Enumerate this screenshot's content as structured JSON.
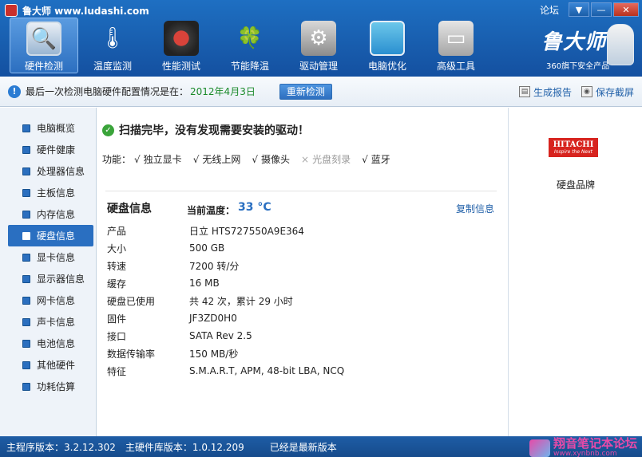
{
  "window": {
    "title": "鲁大师 www.ludashi.com",
    "forum_label": "论坛",
    "ctrl_menu": "▼",
    "ctrl_min": "—",
    "ctrl_close": "✕"
  },
  "toolbar": {
    "items": [
      {
        "label": "硬件检测",
        "icon": "monitor-magnifier-icon"
      },
      {
        "label": "温度监测",
        "icon": "thermometer-icon"
      },
      {
        "label": "性能测试",
        "icon": "speed-gauge-icon"
      },
      {
        "label": "节能降温",
        "icon": "clover-leaf-icon"
      },
      {
        "label": "驱动管理",
        "icon": "toolbox-icon"
      },
      {
        "label": "电脑优化",
        "icon": "display-icon"
      },
      {
        "label": "高级工具",
        "icon": "toolcase-icon"
      }
    ],
    "active_index": 0
  },
  "brand": {
    "logo_text": "鲁大师",
    "subtitle": "360旗下安全产品"
  },
  "infobar": {
    "text": "最后一次检测电脑硬件配置情况是在：",
    "date": "2012年4月3日",
    "recheck_label": "重新检测",
    "report_label": "生成报告",
    "screenshot_label": "保存截屏"
  },
  "sidebar": {
    "items": [
      {
        "label": "电脑概览"
      },
      {
        "label": "硬件健康"
      },
      {
        "label": "处理器信息"
      },
      {
        "label": "主板信息"
      },
      {
        "label": "内存信息"
      },
      {
        "label": "硬盘信息"
      },
      {
        "label": "显卡信息"
      },
      {
        "label": "显示器信息"
      },
      {
        "label": "网卡信息"
      },
      {
        "label": "声卡信息"
      },
      {
        "label": "电池信息"
      },
      {
        "label": "其他硬件"
      },
      {
        "label": "功耗估算"
      }
    ],
    "active_index": 5
  },
  "main": {
    "scan_message": "扫描完毕，没有发现需要安装的驱动！",
    "features_label": "功能：",
    "features": [
      {
        "mark": "√",
        "label": "独立显卡",
        "enabled": true
      },
      {
        "mark": "√",
        "label": "无线上网",
        "enabled": true
      },
      {
        "mark": "√",
        "label": "摄像头",
        "enabled": true
      },
      {
        "mark": "×",
        "label": "光盘刻录",
        "enabled": false
      },
      {
        "mark": "√",
        "label": "蓝牙",
        "enabled": true
      }
    ],
    "disk_title": "硬盘信息",
    "temp_label": "当前温度：",
    "temp_value": "33 °C",
    "copy_label": "复制信息",
    "specs": [
      {
        "key": "产品",
        "value": "日立  HTS727550A9E364"
      },
      {
        "key": "大小",
        "value": "500 GB"
      },
      {
        "key": "转速",
        "value": "7200 转/分"
      },
      {
        "key": "缓存",
        "value": "16 MB"
      },
      {
        "key": "硬盘已使用",
        "value": "共 42 次，累计 29 小时"
      },
      {
        "key": "固件",
        "value": "JF3ZD0H0"
      },
      {
        "key": "接口",
        "value": "SATA Rev 2.5"
      },
      {
        "key": "数据传输率",
        "value": "150 MB/秒"
      },
      {
        "key": "特征",
        "value": "S.M.A.R.T,  APM,  48-bit LBA,  NCQ"
      }
    ]
  },
  "right_panel": {
    "logo_line1": "HITACHI",
    "logo_line2": "Inspire the Next",
    "caption": "硬盘品牌",
    "brand_color": "#d7241f"
  },
  "statusbar": {
    "main_version": "主程序版本：3.2.12.302",
    "db_version": "主硬件库版本：1.0.12.209",
    "latest": "已经是最新版本",
    "watermark_text": "翔音笔记本论坛",
    "watermark_url": "www.xynbnb.com"
  }
}
